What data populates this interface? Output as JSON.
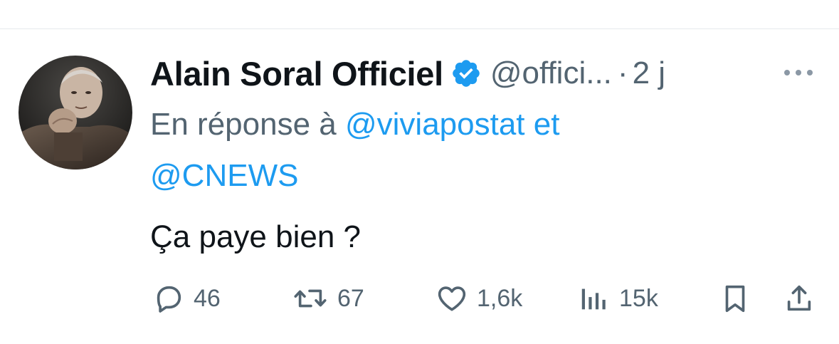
{
  "tweet": {
    "author": {
      "display_name": "Alain Soral Officiel",
      "handle": "@offici...",
      "verified": true
    },
    "separator": "·",
    "time": "2 j",
    "reply_context": {
      "prefix": "En réponse à",
      "mention_1": "@viviapostat",
      "conjunction": "et",
      "mention_2": "@CNEWS"
    },
    "text": "Ça paye bien ?",
    "actions": {
      "replies": "46",
      "reposts": "67",
      "likes": "1,6k",
      "views": "15k"
    }
  },
  "colors": {
    "text_primary": "#0f1419",
    "text_secondary": "#536471",
    "accent": "#1d9bf0",
    "divider": "#e6e9ec"
  },
  "icons": {
    "verified": "verified-badge-icon",
    "more": "more-horizontal-icon",
    "reply": "reply-bubble-icon",
    "repost": "repost-arrows-icon",
    "like": "heart-icon",
    "views": "bar-chart-icon",
    "bookmark": "bookmark-icon",
    "share": "share-upload-icon"
  }
}
